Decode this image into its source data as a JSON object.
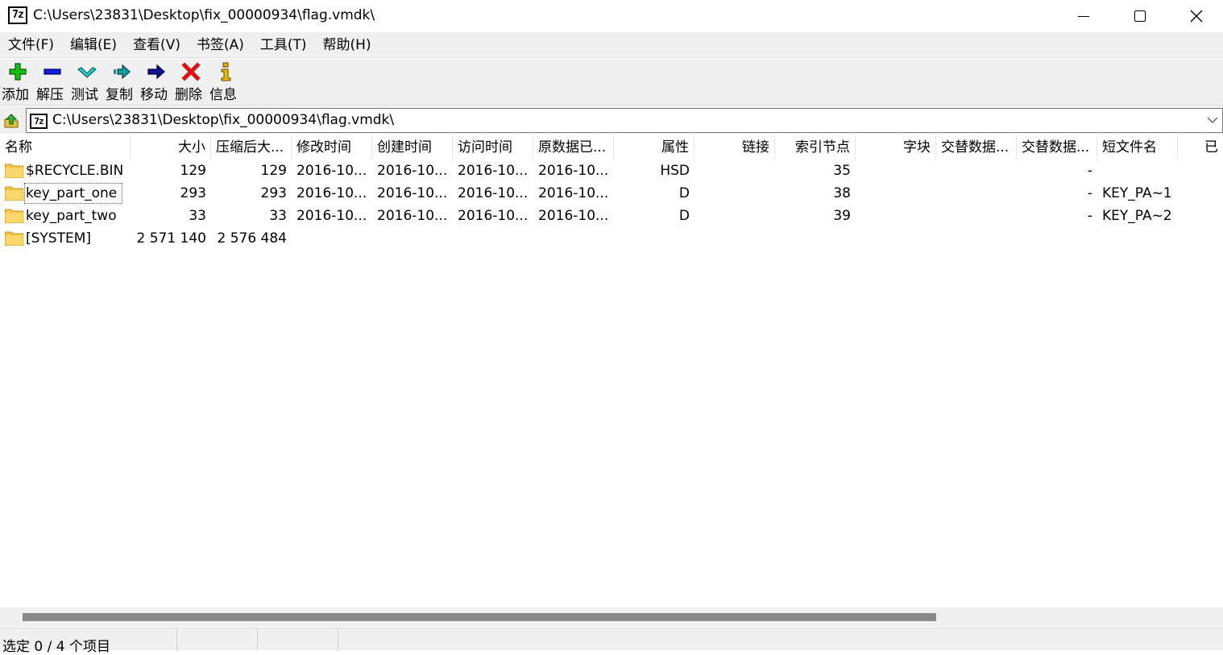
{
  "window": {
    "title": "C:\\Users\\23831\\Desktop\\fix_00000934\\flag.vmdk\\",
    "logo_text": "7z"
  },
  "menu": [
    "文件(F)",
    "编辑(E)",
    "查看(V)",
    "书签(A)",
    "工具(T)",
    "帮助(H)"
  ],
  "toolbar": [
    {
      "label": "添加",
      "icon": "plus-icon",
      "color": "#00b000"
    },
    {
      "label": "解压",
      "icon": "minus-icon",
      "color": "#0000cc"
    },
    {
      "label": "测试",
      "icon": "check-icon",
      "color": "#00b0b0"
    },
    {
      "label": "复制",
      "icon": "copy-arrow-icon",
      "color": "#008080"
    },
    {
      "label": "移动",
      "icon": "move-arrow-icon",
      "color": "#000080"
    },
    {
      "label": "删除",
      "icon": "delete-x-icon",
      "color": "#dd0000"
    },
    {
      "label": "信息",
      "icon": "info-icon",
      "color": "#c8a000"
    }
  ],
  "address": {
    "path": "C:\\Users\\23831\\Desktop\\fix_00000934\\flag.vmdk\\",
    "logo_text": "7z"
  },
  "columns": [
    "名称",
    "大小",
    "压缩后大...",
    "修改时间",
    "创建时间",
    "访问时间",
    "原数据已...",
    "属性",
    "链接",
    "索引节点",
    "字块",
    "交替数据...",
    "交替数据...",
    "短文件名",
    "已"
  ],
  "rows": [
    {
      "name": "$RECYCLE.BIN",
      "size": "129",
      "packed": "129",
      "modified": "2016-10...",
      "created": "2016-10...",
      "accessed": "2016-10...",
      "meta": "2016-10...",
      "attr": "HSD",
      "links": "",
      "inode": "35",
      "blocks": "",
      "alt1": "",
      "alt2": "-",
      "short": ""
    },
    {
      "name": "key_part_one",
      "size": "293",
      "packed": "293",
      "modified": "2016-10...",
      "created": "2016-10...",
      "accessed": "2016-10...",
      "meta": "2016-10...",
      "attr": "D",
      "links": "",
      "inode": "38",
      "blocks": "",
      "alt1": "",
      "alt2": "-",
      "short": "KEY_PA~1"
    },
    {
      "name": "key_part_two",
      "size": "33",
      "packed": "33",
      "modified": "2016-10...",
      "created": "2016-10...",
      "accessed": "2016-10...",
      "meta": "2016-10...",
      "attr": "D",
      "links": "",
      "inode": "39",
      "blocks": "",
      "alt1": "",
      "alt2": "-",
      "short": "KEY_PA~2"
    },
    {
      "name": "[SYSTEM]",
      "size": "2 571 140",
      "packed": "2 576 484",
      "modified": "",
      "created": "",
      "accessed": "",
      "meta": "",
      "attr": "",
      "links": "",
      "inode": "",
      "blocks": "",
      "alt1": "",
      "alt2": "",
      "short": ""
    }
  ],
  "status": {
    "selection": "选定 0 / 4 个项目"
  },
  "colors": {
    "folder": "#f5c542",
    "chrome": "#f0f0f0"
  }
}
